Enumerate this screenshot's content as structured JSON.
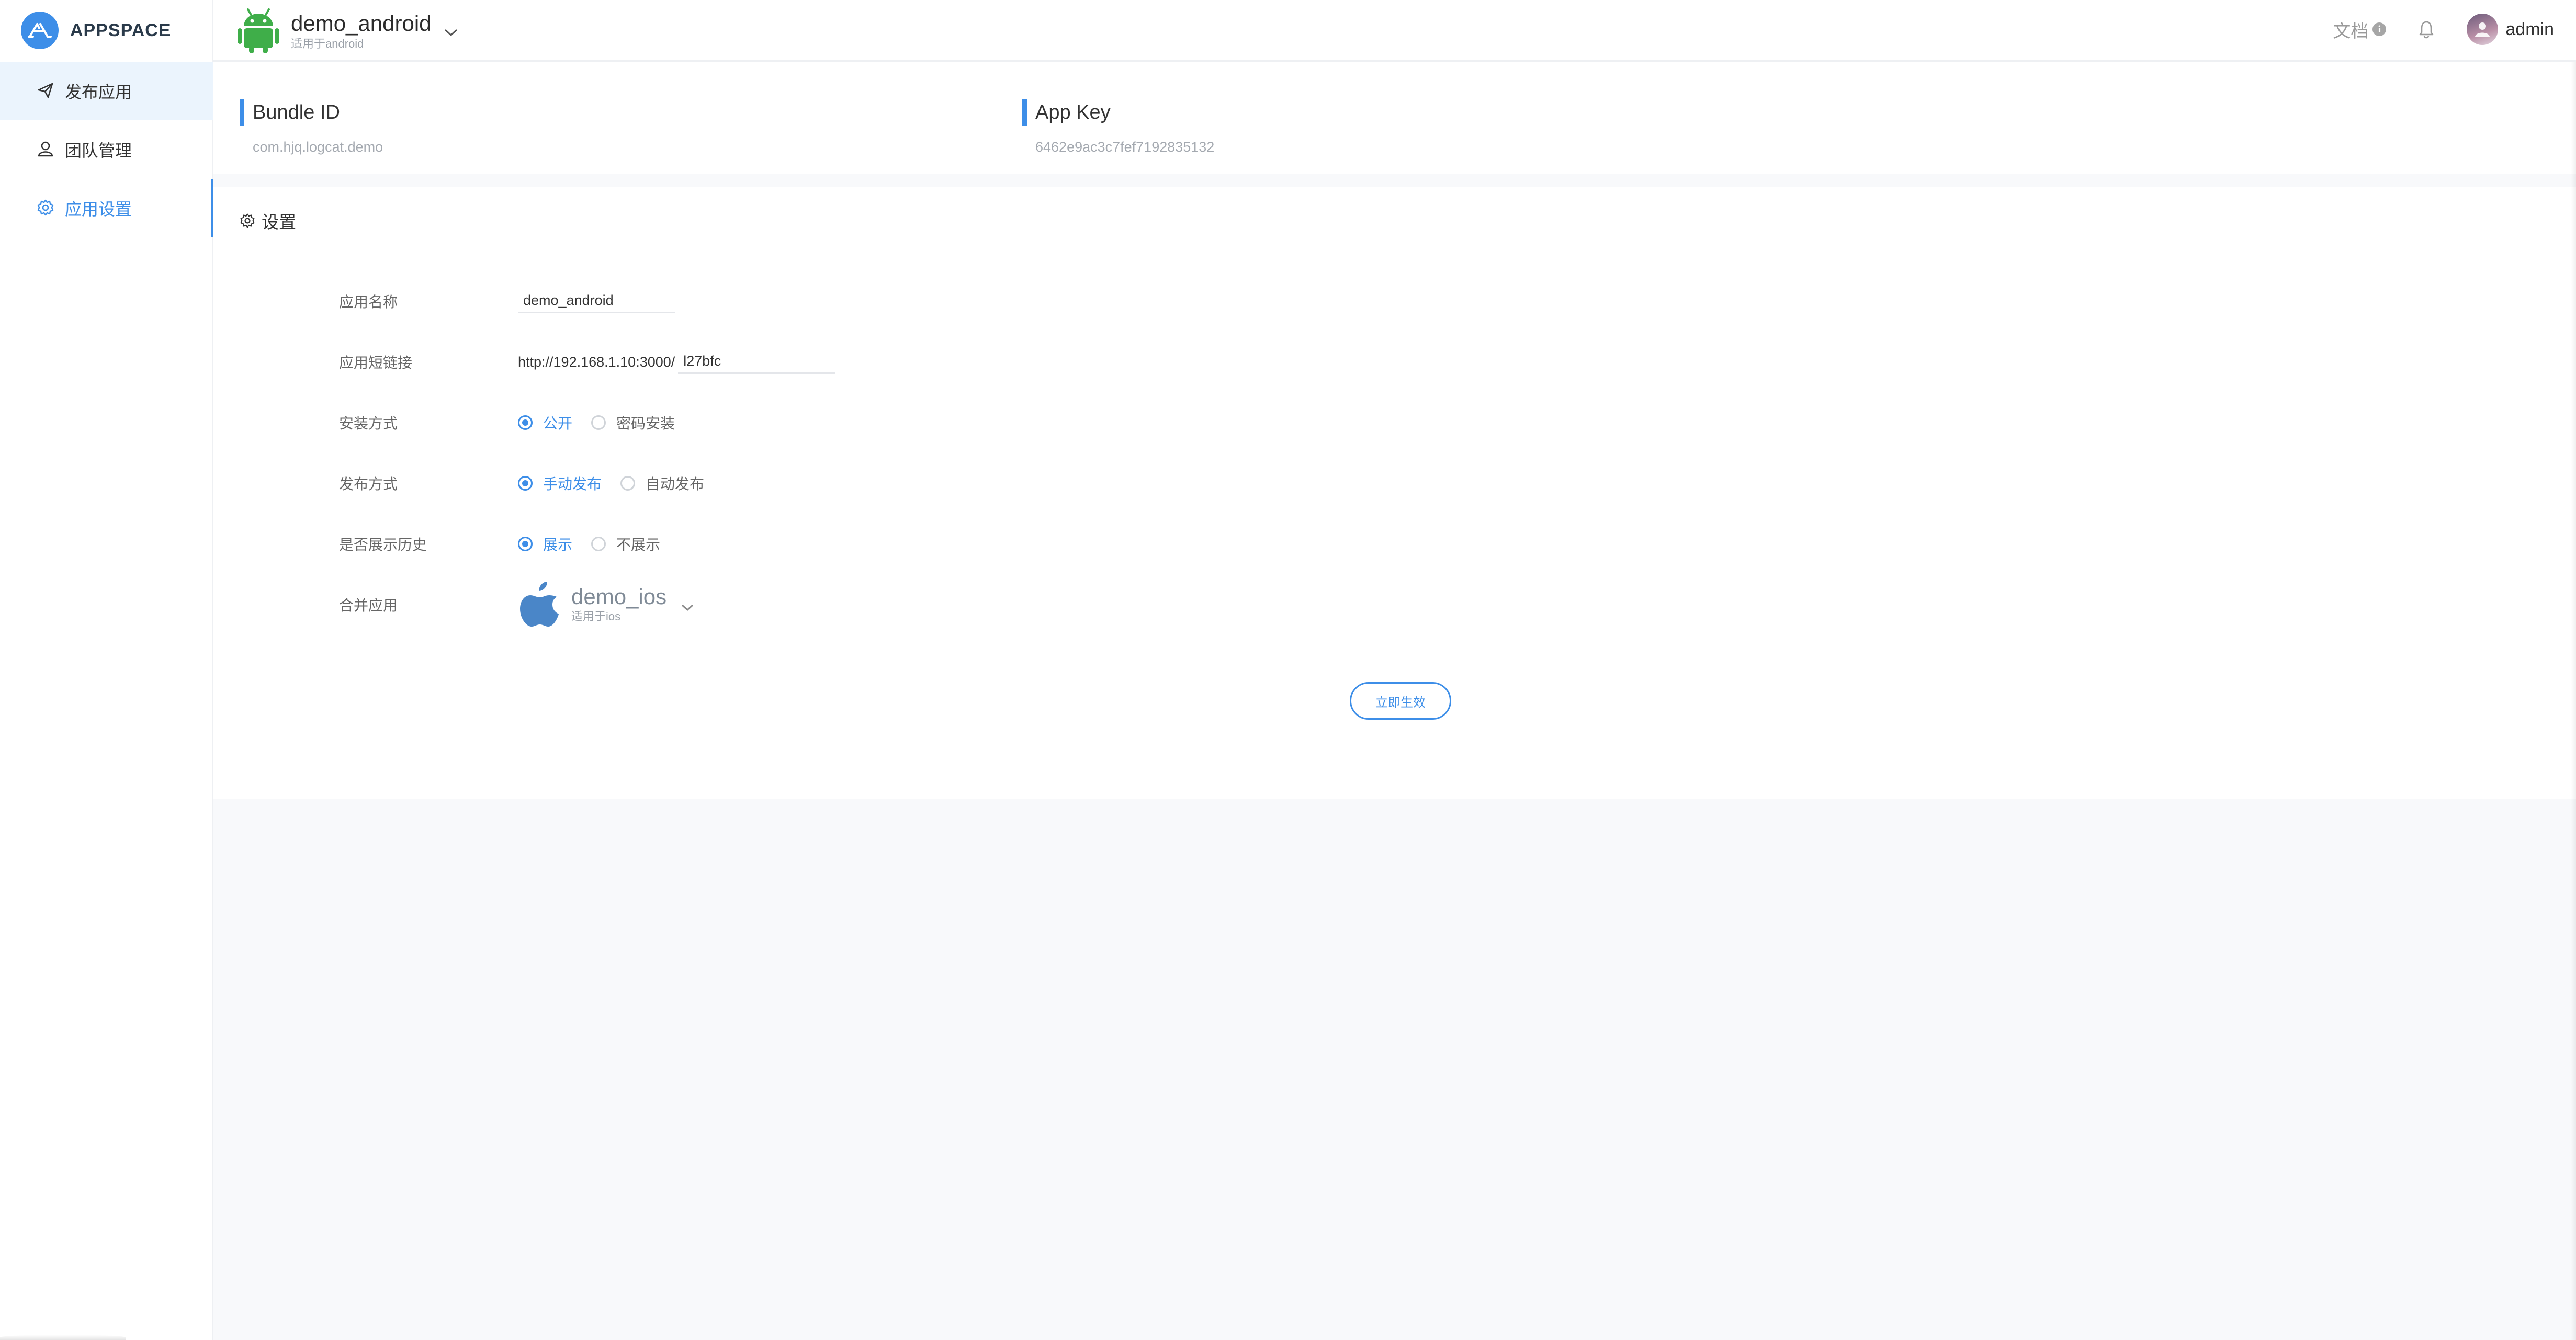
{
  "brand": {
    "name": "APPSPACE",
    "color": "#3d8ee8"
  },
  "sidebar": {
    "items": [
      {
        "label": "发布应用",
        "icon": "send-icon"
      },
      {
        "label": "团队管理",
        "icon": "team-icon"
      },
      {
        "label": "应用设置",
        "icon": "gear-icon",
        "selected": true
      }
    ]
  },
  "header": {
    "app_name": "demo_android",
    "app_platform": "适用于android",
    "docs_label": "文档",
    "user_name": "admin"
  },
  "info": {
    "bundle_id_label": "Bundle ID",
    "bundle_id_value": "com.hjq.logcat.demo",
    "app_key_label": "App Key",
    "app_key_value": "6462e9ac3c7fef7192835132"
  },
  "settings": {
    "title": "设置",
    "app_name_label": "应用名称",
    "app_name_value": "demo_android",
    "short_link_label": "应用短链接",
    "short_link_prefix": "http://192.168.1.10:3000/",
    "short_link_value": "l27bfc",
    "install_label": "安装方式",
    "install_options": [
      "公开",
      "密码安装"
    ],
    "install_selected": "公开",
    "publish_label": "发布方式",
    "publish_options": [
      "手动发布",
      "自动发布"
    ],
    "publish_selected": "手动发布",
    "history_label": "是否展示历史",
    "history_options": [
      "展示",
      "不展示"
    ],
    "history_selected": "展示",
    "merge_label": "合并应用",
    "merge_app_name": "demo_ios",
    "merge_app_platform": "适用于ios",
    "apply_button": "立即生效"
  }
}
